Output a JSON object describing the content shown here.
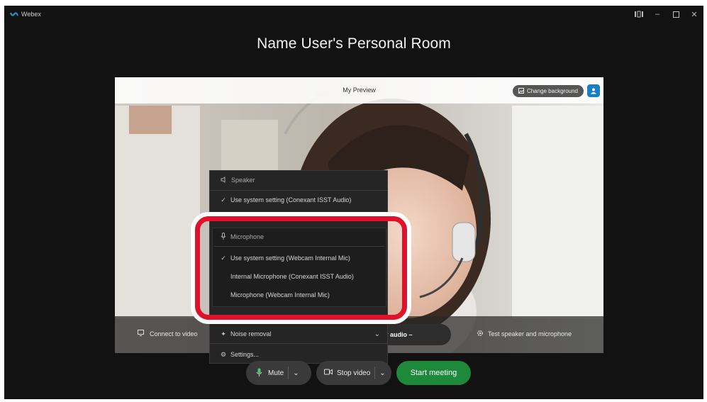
{
  "app": {
    "name": "Webex"
  },
  "room_title": "Name User's Personal Room",
  "preview": {
    "label": "My Preview",
    "change_background": "Change background"
  },
  "bottom": {
    "connect_video": "Connect to video",
    "audio_pill": "r audio –",
    "test_speaker": "Test speaker and microphone"
  },
  "menu": {
    "speaker_header": "Speaker",
    "speaker_option": "Use system setting (Conexant ISST Audio)",
    "microphone_header": "Microphone",
    "mic_options": [
      "Use system setting (Webcam Internal Mic)",
      "Internal Microphone (Conexant ISST Audio)",
      "Microphone (Webcam Internal Mic)"
    ],
    "noise_removal": "Noise removal",
    "settings": "Settings..."
  },
  "controls": {
    "mute": "Mute",
    "stop_video": "Stop video",
    "start_meeting": "Start meeting"
  },
  "colors": {
    "highlight": "#e0112b",
    "start_button": "#1d8a3b",
    "accent": "#1a7ec4"
  }
}
